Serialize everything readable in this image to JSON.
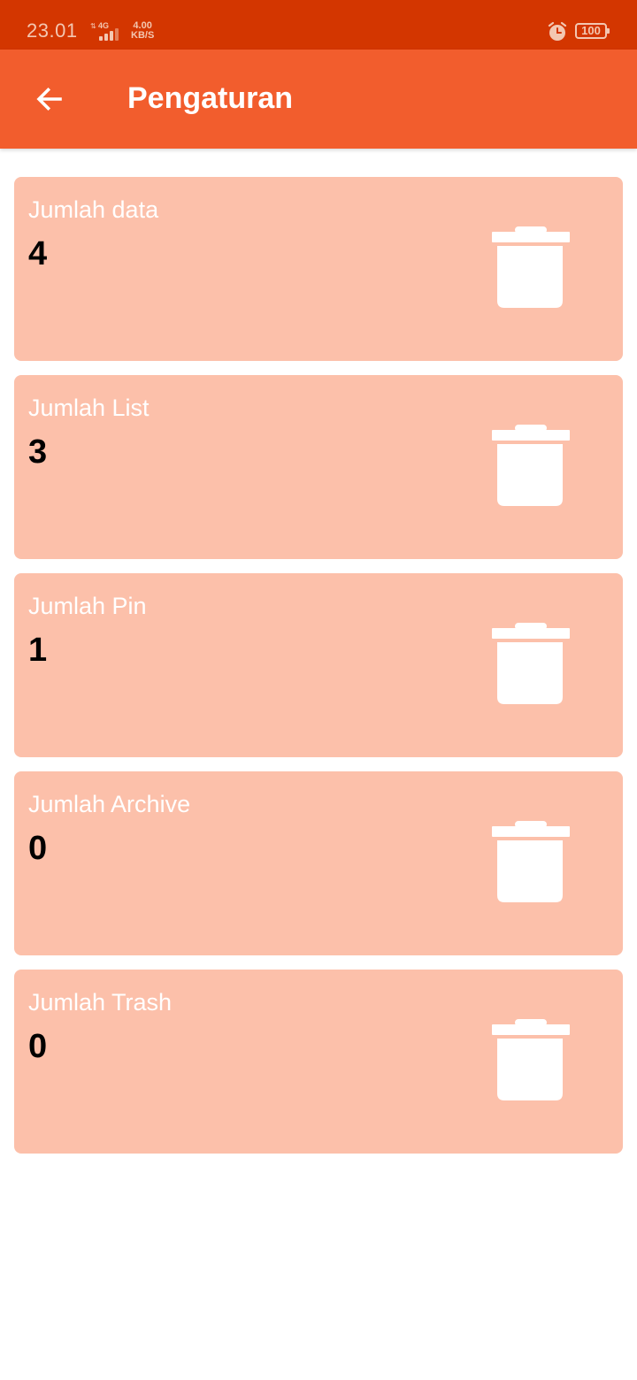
{
  "status_bar": {
    "time": "23.01",
    "network": "4G",
    "speed_value": "4.00",
    "speed_unit": "KB/S",
    "battery": "100",
    "icons": [
      "signal-icon",
      "alarm-icon",
      "battery-icon"
    ]
  },
  "app_bar": {
    "title": "Pengaturan",
    "back_icon": "arrow-left-icon"
  },
  "cards": [
    {
      "label": "Jumlah data",
      "value": "4",
      "icon": "trash-icon"
    },
    {
      "label": "Jumlah List",
      "value": "3",
      "icon": "trash-icon"
    },
    {
      "label": "Jumlah Pin",
      "value": "1",
      "icon": "trash-icon"
    },
    {
      "label": "Jumlah Archive",
      "value": "0",
      "icon": "trash-icon"
    },
    {
      "label": "Jumlah Trash",
      "value": "0",
      "icon": "trash-icon"
    }
  ],
  "colors": {
    "status_bar": "#d33600",
    "app_bar": "#f25d2d",
    "card": "#fcc0aa",
    "icon": "#ffffff"
  }
}
